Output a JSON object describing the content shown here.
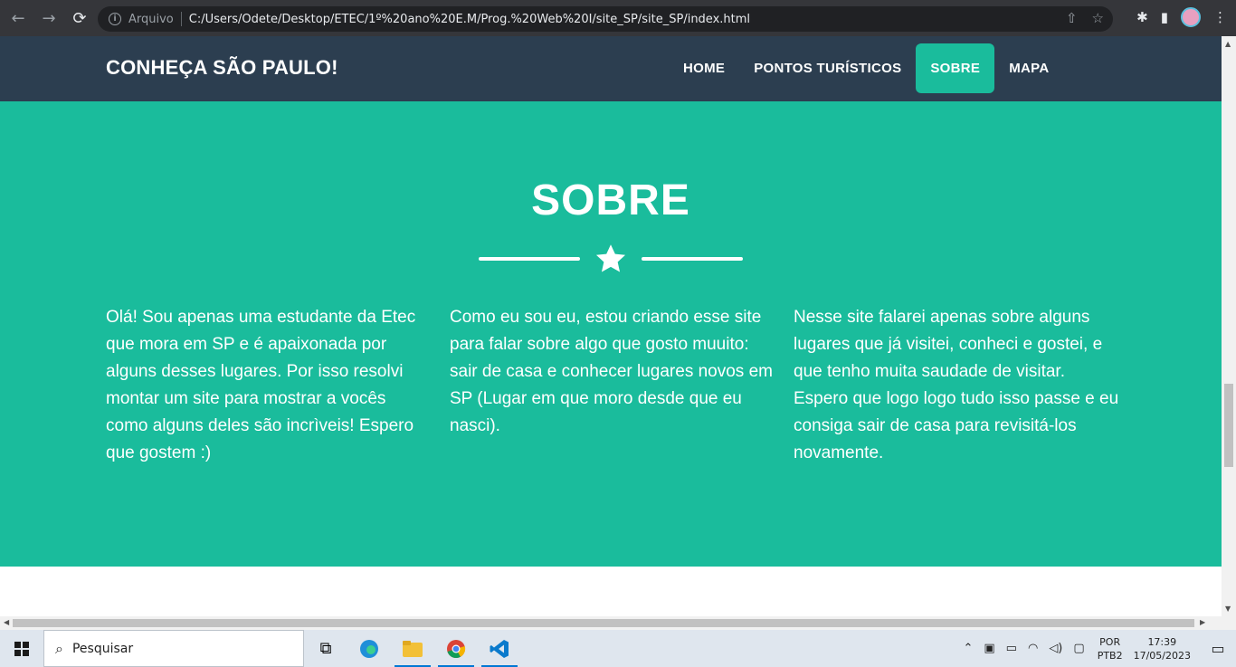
{
  "browser": {
    "back_icon": "←",
    "forward_icon": "→",
    "reload_icon": "⟳",
    "security_label": "Arquivo",
    "url": "C:/Users/Odete/Desktop/ETEC/1º%20ano%20E.M/Prog.%20Web%20I/site_SP/site_SP/index.html",
    "share_icon": "⇧",
    "bookmark_icon": "☆",
    "extensions_icon": "✱",
    "sidepanel_icon": "▮",
    "menu_icon": "⋮"
  },
  "site": {
    "brand": "CONHEÇA SÃO PAULO!",
    "menu": [
      {
        "label": "HOME"
      },
      {
        "label": "PONTOS TURÍSTICOS"
      },
      {
        "label": "SOBRE"
      },
      {
        "label": "MAPA"
      }
    ],
    "about": {
      "title": "SOBRE",
      "columns": [
        "Olá! Sou apenas uma estudante da Etec que mora em SP e é apaixonada por alguns desses lugares. Por isso resolvi montar um site para mostrar a vocês como alguns deles são incrìveis! Espero que gostem :)",
        "Como eu sou eu, estou criando esse site para falar sobre algo que gosto muuito: sair de casa e conhecer lugares novos em SP (Lugar em que moro desde que eu nasci).",
        "Nesse site falarei apenas sobre alguns lugares que já visitei, conheci e gostei, e que tenho muita saudade de visitar. Espero que logo logo tudo isso passe e eu consiga sair de casa para revisitá-los novamente."
      ]
    }
  },
  "taskbar": {
    "search_placeholder": "Pesquisar",
    "lang_top": "POR",
    "lang_bottom": "PTB2",
    "time": "17:39",
    "date": "17/05/2023"
  },
  "colors": {
    "nav_bg": "#2c3e50",
    "accent": "#1abc9c"
  }
}
